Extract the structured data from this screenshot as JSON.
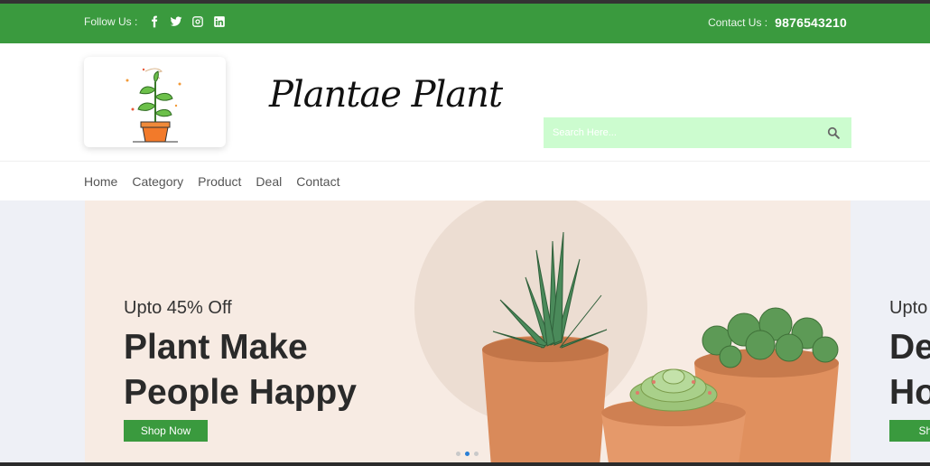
{
  "colors": {
    "brand_green": "#3a9a3e",
    "search_bg": "#ccfccf",
    "slide_bg": "#f7ebe3",
    "dot_active": "#2a7fd6"
  },
  "topbar": {
    "follow_label": "Follow Us :",
    "social_icons": [
      "facebook-icon",
      "twitter-icon",
      "instagram-icon",
      "linkedin-icon"
    ],
    "contact_label": "Contact Us :",
    "contact_phone": "9876543210"
  },
  "header": {
    "brand_name": "Plantae Plant",
    "search_placeholder": "Search Here..."
  },
  "nav": {
    "items": [
      "Home",
      "Category",
      "Product",
      "Deal",
      "Contact"
    ]
  },
  "slider": {
    "current": {
      "subtitle": "Upto 45% Off",
      "title_line1": "Plant Make",
      "title_line2": "People Happy",
      "button_label": "Shop Now"
    },
    "next": {
      "subtitle": "Upto",
      "title_line1": "De",
      "title_line2": "Ho",
      "button_label": "Shop"
    },
    "dots_count": 3,
    "active_dot": 2
  }
}
